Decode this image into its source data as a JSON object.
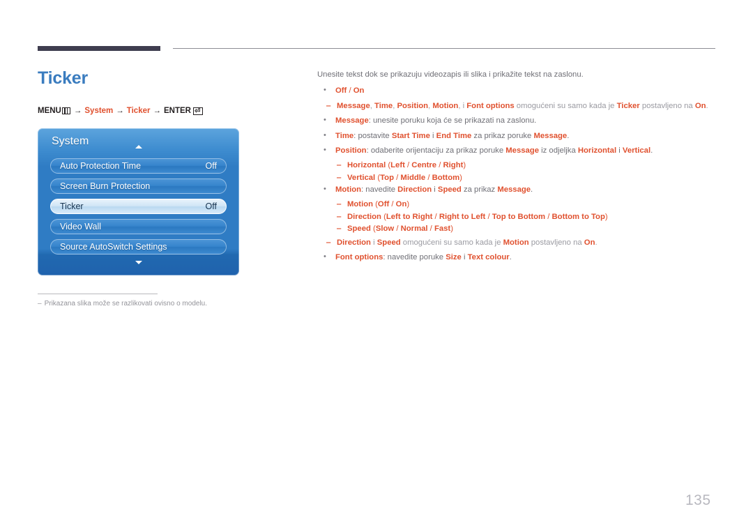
{
  "page": {
    "title": "Ticker",
    "number": "135"
  },
  "menu_path": {
    "menu_label": "MENU",
    "menu_icon": "menu-bars-icon",
    "arrow": "→",
    "system": "System",
    "ticker": "Ticker",
    "enter_label": "ENTER",
    "enter_icon": "enter-key-icon",
    "enter_glyph": "⏎"
  },
  "osd": {
    "title": "System",
    "scroll_up_icon": "chevron-up-icon",
    "scroll_down_icon": "chevron-down-icon",
    "rows": [
      {
        "label": "Auto Protection Time",
        "value": "Off",
        "selected": false
      },
      {
        "label": "Screen Burn Protection",
        "value": "",
        "selected": false
      },
      {
        "label": "Ticker",
        "value": "Off",
        "selected": true
      },
      {
        "label": "Video Wall",
        "value": "",
        "selected": false
      },
      {
        "label": "Source AutoSwitch Settings",
        "value": "",
        "selected": false
      }
    ]
  },
  "footnote": {
    "dash": "‒",
    "text": "Prikazana slika može se razlikovati ovisno o modelu."
  },
  "content": {
    "intro": "Unesite tekst dok se prikazuju videozapis ili slika i prikažite tekst na zaslonu.",
    "bullet_marker": "•",
    "dash_marker": "‒",
    "note_marker": "‒",
    "items": [
      {
        "type": "bullet",
        "parts": [
          {
            "t": "Off",
            "s": "o"
          },
          {
            "t": " / ",
            "s": "ol"
          },
          {
            "t": "On",
            "s": "o"
          }
        ]
      },
      {
        "type": "subnote",
        "parts": [
          {
            "t": "Message",
            "s": "o"
          },
          {
            "t": ", ",
            "s": "gl"
          },
          {
            "t": "Time",
            "s": "o"
          },
          {
            "t": ", ",
            "s": "gl"
          },
          {
            "t": "Position",
            "s": "o"
          },
          {
            "t": ", ",
            "s": "gl"
          },
          {
            "t": "Motion",
            "s": "o"
          },
          {
            "t": ", i ",
            "s": "gl"
          },
          {
            "t": "Font options",
            "s": "o"
          },
          {
            "t": " omogućeni su samo kada je ",
            "s": "gl"
          },
          {
            "t": "Ticker",
            "s": "o"
          },
          {
            "t": " postavljeno na ",
            "s": "gl"
          },
          {
            "t": "On",
            "s": "o"
          },
          {
            "t": ".",
            "s": "gl"
          }
        ]
      },
      {
        "type": "bullet",
        "parts": [
          {
            "t": "Message",
            "s": "o"
          },
          {
            "t": ": unesite poruku koja će se prikazati na zaslonu.",
            "s": "g"
          }
        ]
      },
      {
        "type": "bullet",
        "parts": [
          {
            "t": "Time",
            "s": "o"
          },
          {
            "t": ": postavite ",
            "s": "g"
          },
          {
            "t": "Start Time",
            "s": "o"
          },
          {
            "t": " i ",
            "s": "g"
          },
          {
            "t": "End Time",
            "s": "o"
          },
          {
            "t": " za prikaz poruke ",
            "s": "g"
          },
          {
            "t": "Message",
            "s": "o"
          },
          {
            "t": ".",
            "s": "g"
          }
        ]
      },
      {
        "type": "bullet",
        "parts": [
          {
            "t": "Position",
            "s": "o"
          },
          {
            "t": ": odaberite orijentaciju za prikaz poruke ",
            "s": "g"
          },
          {
            "t": "Message",
            "s": "o"
          },
          {
            "t": " iz odjeljka ",
            "s": "g"
          },
          {
            "t": "Horizontal",
            "s": "o"
          },
          {
            "t": " i ",
            "s": "g"
          },
          {
            "t": "Vertical",
            "s": "o"
          },
          {
            "t": ".",
            "s": "g"
          }
        ]
      },
      {
        "type": "subitem",
        "parts": [
          {
            "t": "Horizontal",
            "s": "o"
          },
          {
            "t": " (",
            "s": "ol"
          },
          {
            "t": "Left",
            "s": "o"
          },
          {
            "t": " / ",
            "s": "ol"
          },
          {
            "t": "Centre",
            "s": "o"
          },
          {
            "t": " / ",
            "s": "ol"
          },
          {
            "t": "Right",
            "s": "o"
          },
          {
            "t": ")",
            "s": "ol"
          }
        ]
      },
      {
        "type": "subitem",
        "parts": [
          {
            "t": "Vertical",
            "s": "o"
          },
          {
            "t": " (",
            "s": "ol"
          },
          {
            "t": "Top",
            "s": "o"
          },
          {
            "t": " / ",
            "s": "ol"
          },
          {
            "t": "Middle",
            "s": "o"
          },
          {
            "t": " / ",
            "s": "ol"
          },
          {
            "t": "Bottom",
            "s": "o"
          },
          {
            "t": ")",
            "s": "ol"
          }
        ]
      },
      {
        "type": "bullet",
        "parts": [
          {
            "t": "Motion",
            "s": "o"
          },
          {
            "t": ": navedite ",
            "s": "g"
          },
          {
            "t": "Direction",
            "s": "o"
          },
          {
            "t": " i ",
            "s": "g"
          },
          {
            "t": "Speed",
            "s": "o"
          },
          {
            "t": " za prikaz ",
            "s": "g"
          },
          {
            "t": "Message",
            "s": "o"
          },
          {
            "t": ".",
            "s": "g"
          }
        ]
      },
      {
        "type": "subitem",
        "parts": [
          {
            "t": "Motion",
            "s": "o"
          },
          {
            "t": " (",
            "s": "ol"
          },
          {
            "t": "Off",
            "s": "o"
          },
          {
            "t": " / ",
            "s": "ol"
          },
          {
            "t": "On",
            "s": "o"
          },
          {
            "t": ")",
            "s": "ol"
          }
        ]
      },
      {
        "type": "subitem",
        "parts": [
          {
            "t": "Direction",
            "s": "o"
          },
          {
            "t": " (",
            "s": "ol"
          },
          {
            "t": "Left to Right",
            "s": "o"
          },
          {
            "t": " / ",
            "s": "ol"
          },
          {
            "t": "Right to Left",
            "s": "o"
          },
          {
            "t": " / ",
            "s": "ol"
          },
          {
            "t": "Top to Bottom",
            "s": "o"
          },
          {
            "t": " / ",
            "s": "ol"
          },
          {
            "t": "Bottom to Top",
            "s": "o"
          },
          {
            "t": ")",
            "s": "ol"
          }
        ]
      },
      {
        "type": "subitem",
        "parts": [
          {
            "t": "Speed",
            "s": "o"
          },
          {
            "t": " (",
            "s": "ol"
          },
          {
            "t": "Slow",
            "s": "o"
          },
          {
            "t": " / ",
            "s": "ol"
          },
          {
            "t": "Normal",
            "s": "o"
          },
          {
            "t": " / ",
            "s": "ol"
          },
          {
            "t": "Fast",
            "s": "o"
          },
          {
            "t": ")",
            "s": "ol"
          }
        ]
      },
      {
        "type": "subnote",
        "parts": [
          {
            "t": "Direction",
            "s": "o"
          },
          {
            "t": " i ",
            "s": "gl"
          },
          {
            "t": "Speed",
            "s": "o"
          },
          {
            "t": " omogućeni su samo kada je ",
            "s": "gl"
          },
          {
            "t": "Motion",
            "s": "o"
          },
          {
            "t": " postavljeno na ",
            "s": "gl"
          },
          {
            "t": "On",
            "s": "o"
          },
          {
            "t": ".",
            "s": "gl"
          }
        ]
      },
      {
        "type": "bullet",
        "parts": [
          {
            "t": "Font options",
            "s": "o"
          },
          {
            "t": ": navedite poruke ",
            "s": "g"
          },
          {
            "t": "Size",
            "s": "o"
          },
          {
            "t": " i ",
            "s": "g"
          },
          {
            "t": "Text colour",
            "s": "o"
          },
          {
            "t": ".",
            "s": "g"
          }
        ]
      }
    ]
  }
}
